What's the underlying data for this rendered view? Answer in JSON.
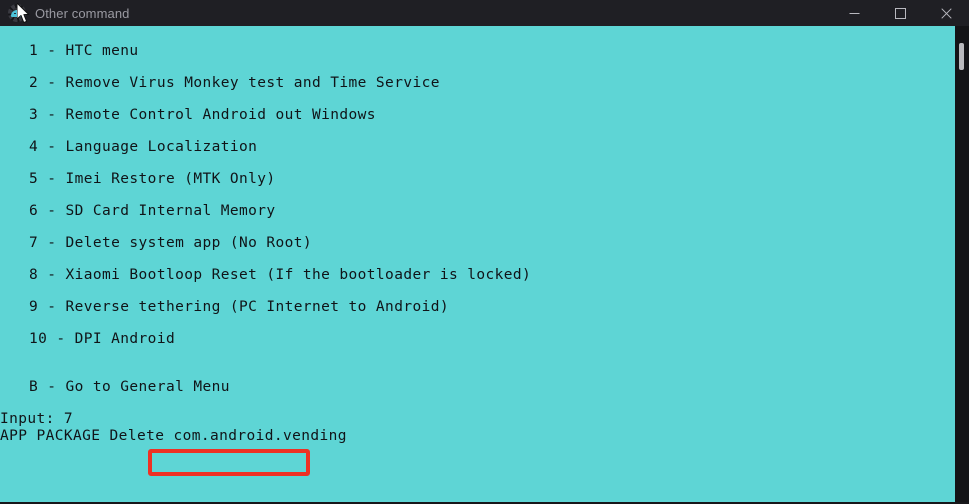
{
  "window": {
    "title": "Other command",
    "icon": "android-gear-icon",
    "colors": {
      "titlebar_bg": "#1f1f24",
      "console_bg": "#5ed5d5",
      "console_fg": "#101418",
      "highlight_border": "#ee3124",
      "title_fg": "#9a9aa2"
    },
    "controls": {
      "minimize": "minimize-icon",
      "maximize": "maximize-icon",
      "close": "close-icon"
    }
  },
  "console": {
    "menu_items": [
      {
        "key": "1",
        "text": "1 - HTC menu"
      },
      {
        "key": "2",
        "text": "2 - Remove Virus Monkey test and Time Service"
      },
      {
        "key": "3",
        "text": "3 - Remote Control Android out Windows"
      },
      {
        "key": "4",
        "text": "4 - Language Localization"
      },
      {
        "key": "5",
        "text": "5 - Imei Restore (MTK Only)"
      },
      {
        "key": "6",
        "text": "6 - SD Card Internal Memory"
      },
      {
        "key": "7",
        "text": "7 - Delete system app (No Root)"
      },
      {
        "key": "8",
        "text": "8 - Xiaomi Bootloop Reset (If the bootloader is locked)"
      },
      {
        "key": "9",
        "text": "9 - Reverse tethering (PC Internet to Android)"
      },
      {
        "key": "10",
        "text": "10 - DPI Android"
      },
      {
        "key": "B",
        "text": "B - Go to General Menu"
      }
    ],
    "input_line": "Input: 7",
    "prompt_label": "APP PACKAGE Delete ",
    "prompt_value": "com.android.vending"
  }
}
